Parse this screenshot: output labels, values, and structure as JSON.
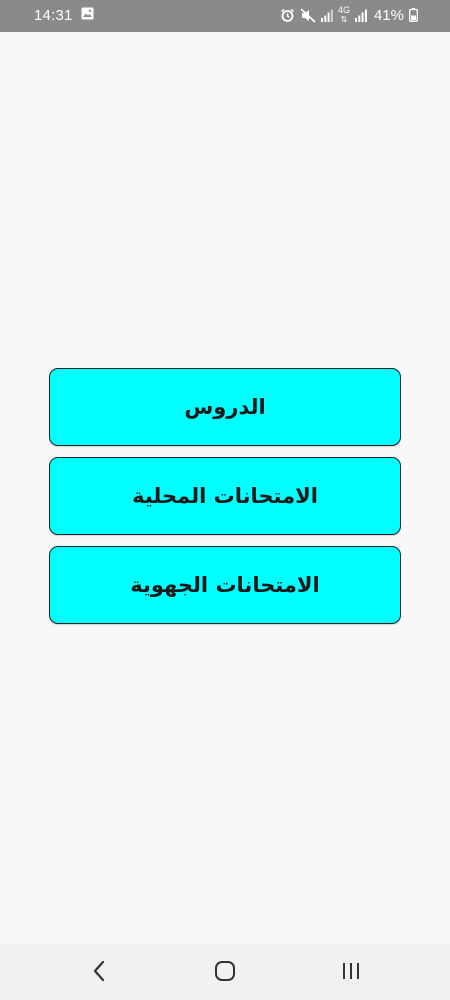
{
  "status_bar": {
    "time": "14:31",
    "network": "4G",
    "battery": "41%",
    "icons": [
      "gallery-icon",
      "alarm-icon",
      "mute-icon",
      "signal-icon",
      "signal-icon",
      "battery-icon"
    ]
  },
  "menu": {
    "buttons": [
      {
        "label": "الدروس"
      },
      {
        "label": "الامتحانات المحلية"
      },
      {
        "label": "الامتحانات الجهوية"
      }
    ]
  },
  "nav_bar": {
    "icons": [
      "back-icon",
      "home-icon",
      "recents-icon"
    ]
  },
  "colors": {
    "status_bar_bg": "#8a8a8a",
    "page_bg": "#f8f7fa",
    "button_bg": "#00ffff",
    "button_border": "#222222",
    "nav_bar_bg": "#f1f0f3"
  }
}
